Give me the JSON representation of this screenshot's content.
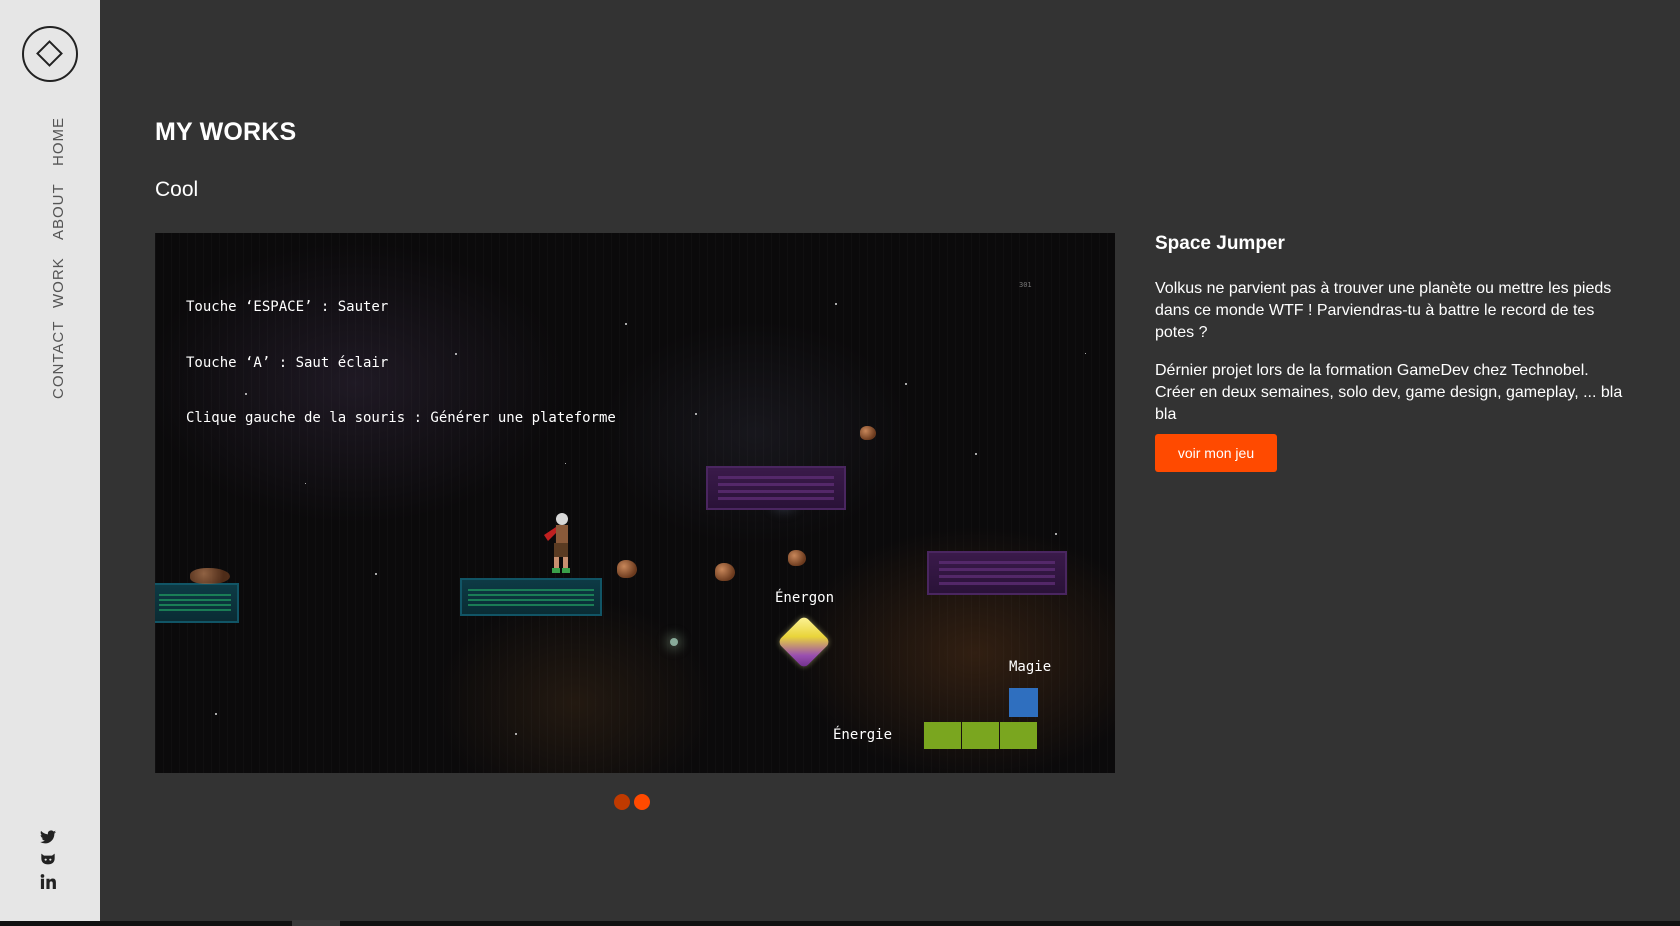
{
  "nav": {
    "items": [
      {
        "label": "HOME"
      },
      {
        "label": "ABOUT"
      },
      {
        "label": "WORK"
      },
      {
        "label": "CONTACT"
      }
    ],
    "social": [
      "twitter-icon",
      "github-icon",
      "linkedin-icon"
    ]
  },
  "main": {
    "title": "MY WORKS",
    "subtitle": "Cool"
  },
  "game": {
    "instructions": [
      "Touche ‘ESPACE’ : Sauter",
      "Touche ‘A’ : Saut éclair",
      "Clique gauche de la souris : Générer une plateforme"
    ],
    "corner_number": "301",
    "energon_label": "Énergon",
    "magic_label": "Magie",
    "energy_label": "Énergie",
    "energy_segments": 3,
    "magic_segments": 1
  },
  "project": {
    "title": "Space Jumper",
    "description_1": "Volkus ne parvient pas à trouver une planète ou mettre les pieds dans ce monde WTF ! Parviendras-tu à battre le record de tes potes ?",
    "description_2": "Dérnier projet lors de la formation GameDev chez Technobel. Créer en deux semaines, solo dev, game design, gameplay, ... bla bla",
    "cta_label": "voir mon jeu"
  },
  "carousel": {
    "slide_count": 2,
    "active_index": 1
  },
  "colors": {
    "accent": "#ff4a00",
    "dot_inactive": "#c03a00",
    "background": "#333333",
    "sidebar": "#e6e6e6"
  }
}
